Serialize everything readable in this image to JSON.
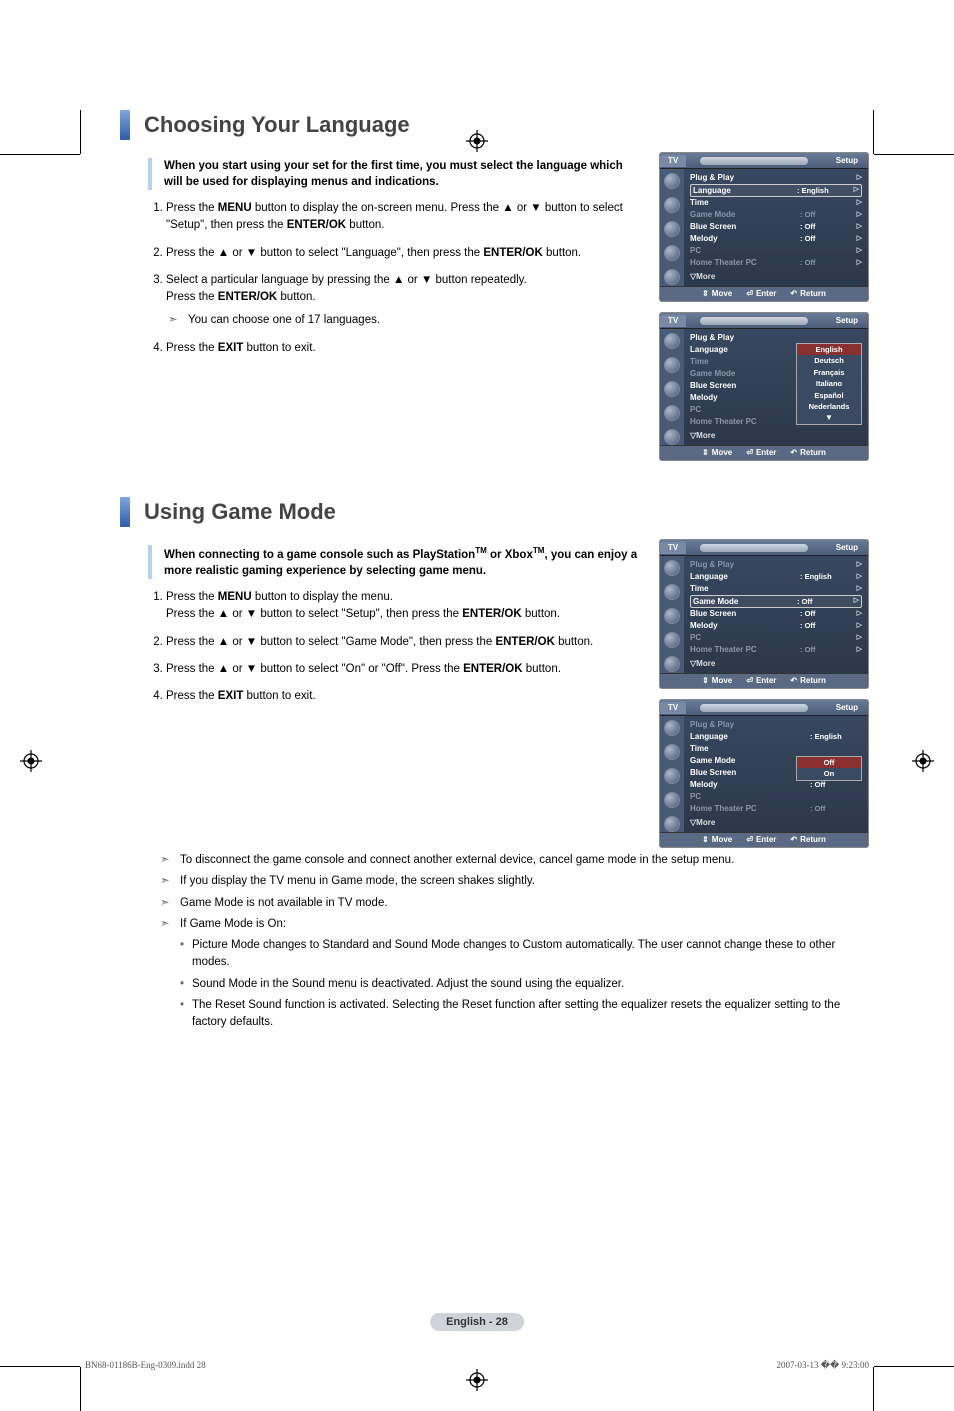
{
  "section1": {
    "title": "Choosing Your Language",
    "intro": "When you start using your set for the first time, you must select the language which will be used for displaying menus and indications.",
    "steps": [
      {
        "pre": "Press the ",
        "b1": "MENU",
        "mid": " button to display the on-screen menu. Press the ▲ or ▼ button to select \"Setup\", then press the ",
        "b2": "ENTER/OK",
        "post": " button."
      },
      {
        "pre": "Press the ▲ or ▼ button to select \"Language\", then press the ",
        "b1": "ENTER/OK",
        "post": " button."
      },
      {
        "pre": "Select a particular language by pressing the ▲ or ▼ button repeatedly.\nPress the ",
        "b1": "ENTER/OK",
        "post": " button.",
        "note": "You can choose one of 17 languages."
      },
      {
        "pre": "Press the ",
        "b1": "EXIT",
        "post": " button to exit."
      }
    ]
  },
  "section2": {
    "title": "Using Game Mode",
    "intro_pre": "When connecting to a game console such as PlayStation",
    "intro_mid": " or Xbox",
    "intro_post": ", you can enjoy a more realistic gaming experience by selecting game menu.",
    "steps": [
      {
        "pre": "Press the ",
        "b1": "MENU",
        "mid": " button to display the menu.\nPress the ▲ or ▼ button to select \"Setup\", then press the ",
        "b2": "ENTER/OK",
        "post": " button."
      },
      {
        "pre": "Press the ▲ or ▼ button to select \"Game Mode\", then press the ",
        "b1": "ENTER/OK",
        "post": " button."
      },
      {
        "pre": "Press the ▲ or ▼ button to select \"On\" or \"Off\". Press the ",
        "b1": "ENTER/OK",
        "post": " button."
      },
      {
        "pre": "Press the ",
        "b1": "EXIT",
        "post": " button to exit."
      }
    ],
    "notes": [
      "To disconnect the game console and connect another external device, cancel game mode in the setup menu.",
      "If you display the TV menu in Game mode, the screen shakes slightly.",
      "Game Mode is not available in TV mode.",
      "If Game Mode is On:"
    ],
    "bullets": [
      "Picture Mode changes to Standard and Sound Mode changes to Custom automatically. The user cannot change these to other modes.",
      "Sound Mode in the Sound menu is deactivated. Adjust the sound using the equalizer.",
      "The Reset Sound function is activated. Selecting the Reset function after setting the equalizer resets the equalizer setting to the factory defaults."
    ]
  },
  "osd_common": {
    "tv": "TV",
    "setup": "Setup",
    "move": "Move",
    "enter": "Enter",
    "return": "Return",
    "more": "▽More"
  },
  "labels": {
    "plug": "Plug & Play",
    "language": "Language",
    "time": "Time",
    "game": "Game Mode",
    "blue": "Blue Screen",
    "melody": "Melody",
    "pc": "PC",
    "htpc": "Home Theater PC"
  },
  "osd1a": {
    "language_val": ": English",
    "game_val": ": Off",
    "blue_val": ": Off",
    "melody_val": ": Off",
    "htpc_val": ": Off"
  },
  "osd1b": {
    "options": [
      "English",
      "Deutsch",
      "Français",
      "Italiano",
      "Español",
      "Nederlands"
    ],
    "selected_index": 0,
    "show_down_arrow": true
  },
  "osd2a": {
    "language_val": ": English",
    "game_val": ": Off",
    "blue_val": ": Off",
    "melody_val": ": Off",
    "htpc_val": ": Off"
  },
  "osd2b": {
    "language_val": ": English",
    "melody_val": ": Off",
    "htpc_val": ": Off",
    "options": [
      "Off",
      "On"
    ],
    "selected_index": 0
  },
  "footer": {
    "page": "English - 28",
    "file": "BN68-01186B-Eng-0309.indd   28",
    "timestamp": "2007-03-13   �� 9:23:00"
  }
}
